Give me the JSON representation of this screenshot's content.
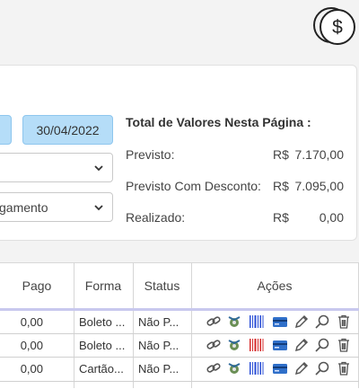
{
  "filters": {
    "end_date": "30/04/2022",
    "select2_value": "gamento"
  },
  "totals": {
    "title": "Total de Valores Nesta Página :",
    "rows": [
      {
        "label": "Previsto:",
        "currency": "R$",
        "value": "7.170,00"
      },
      {
        "label": "Previsto Com Desconto:",
        "currency": "R$",
        "value": "7.095,00"
      },
      {
        "label": "Realizado:",
        "currency": "R$",
        "value": "0,00"
      }
    ]
  },
  "table": {
    "headers": [
      "Pago",
      "Forma",
      "Status",
      "Ações"
    ],
    "rows": [
      {
        "pago": "0,00",
        "forma": "Boleto ...",
        "status": "Não P..."
      },
      {
        "pago": "0,00",
        "forma": "Boleto ...",
        "status": "Não P..."
      },
      {
        "pago": "0,00",
        "forma": "Cartão...",
        "status": "Não P..."
      }
    ],
    "action_icons": [
      "link-icon",
      "money-bag-icon",
      "barcode-icon",
      "credit-card-icon",
      "pencil-icon",
      "search-icon",
      "trash-icon"
    ],
    "barcode_colors": [
      "#2b4fd6",
      "#d62b2b",
      "#2b4fd6"
    ]
  },
  "logo_icon": "dollar-coins-icon"
}
